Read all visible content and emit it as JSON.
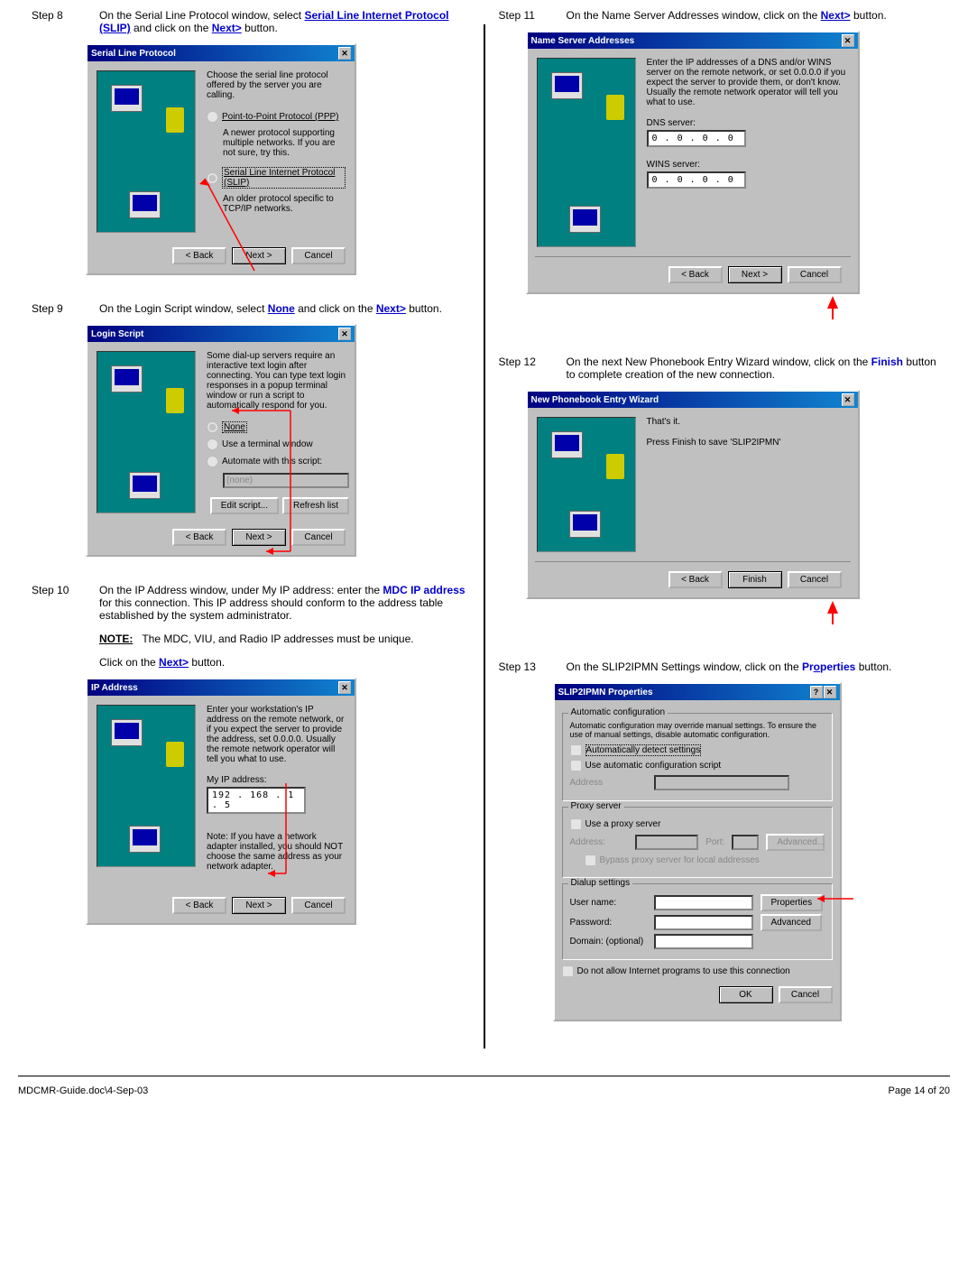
{
  "footer": {
    "left": "MDCMR-Guide.doc\\4-Sep-03",
    "right": "Page 14 of 20"
  },
  "steps": {
    "s8": {
      "label": "Step 8",
      "text_pre": "On the Serial Line Protocol window, select ",
      "text_bold": "Serial Line Internet Protocol (SLIP)",
      "text_mid": " and click on the ",
      "text_next": "Next>",
      "text_post": " button."
    },
    "s9": {
      "label": "Step 9",
      "text_pre": "On the Login Script window, select ",
      "text_bold": "None",
      "text_mid": " and click on the ",
      "text_next": "Next>",
      "text_post": " button."
    },
    "s10": {
      "label": "Step 10",
      "text_pre": "On the IP Address window, under My IP address: enter the ",
      "text_bold": "MDC IP address",
      "text_post": " for this connection.  This IP address should conform to the address table established by the system administrator.",
      "note_label": "NOTE:",
      "note_text": "The MDC, VIU, and Radio IP addresses must be unique.",
      "click_pre": "Click on the ",
      "click_next": "Next>",
      "click_post": " button."
    },
    "s11": {
      "label": "Step 11",
      "text_pre": "On the Name Server Addresses window, click on the ",
      "text_next": "Next>",
      "text_post": " button."
    },
    "s12": {
      "label": "Step 12",
      "text_pre": "On the next New Phonebook Entry Wizard window, click on the ",
      "text_bold": "Finish",
      "text_post": " button to complete creation of the new connection."
    },
    "s13": {
      "label": "Step 13",
      "text_pre": "On the SLIP2IPMN Settings window, click on the ",
      "text_bold": "Properties",
      "text_post": " button."
    }
  },
  "dlg8": {
    "title": "Serial Line Protocol",
    "intro": "Choose the serial line protocol offered by the server you are calling.",
    "opt1": "Point-to-Point Protocol (PPP)",
    "opt1_sub": "A newer protocol supporting multiple networks. If you are not sure, try this.",
    "opt2": "Serial Line Internet Protocol (SLIP)",
    "opt2_sub": "An older protocol specific to TCP/IP networks.",
    "back": "< Back",
    "next": "Next >",
    "cancel": "Cancel"
  },
  "dlg9": {
    "title": "Login Script",
    "intro": "Some dial-up servers require an interactive text login after connecting. You can type text login responses in a popup terminal window or run a script to automatically respond for you.",
    "opt1": "None",
    "opt2": "Use a terminal window",
    "opt3": "Automate with this script:",
    "select_val": "(none)",
    "edit": "Edit script...",
    "refresh": "Refresh list",
    "back": "< Back",
    "next": "Next >",
    "cancel": "Cancel"
  },
  "dlg10": {
    "title": "IP Address",
    "intro": "Enter your workstation's IP address on the remote network, or if you expect the server to provide the address, set 0.0.0.0. Usually the remote network operator will tell you what to use.",
    "field": "My IP address:",
    "ip": "192 . 168 .   1  .   5",
    "note": "Note: If you have a network adapter installed, you should NOT choose the same address as your network adapter.",
    "back": "< Back",
    "next": "Next >",
    "cancel": "Cancel"
  },
  "dlg11": {
    "title": "Name Server Addresses",
    "intro": "Enter the IP addresses of a DNS and/or WINS server on the remote network, or set 0.0.0.0 if you expect the server to provide them, or don't know. Usually the remote network operator will tell you what to use.",
    "dns": "DNS server:",
    "dns_ip": "0  .  0  .   0  .  0",
    "wins": "WINS server:",
    "wins_ip": "0  .  0  .   0  .  0",
    "back": "< Back",
    "next": "Next >",
    "cancel": "Cancel"
  },
  "dlg12": {
    "title": "New Phonebook Entry Wizard",
    "line1": "That's it.",
    "line2": "Press Finish to save 'SLIP2IPMN'",
    "back": "< Back",
    "finish": "Finish",
    "cancel": "Cancel"
  },
  "dlg13": {
    "title": "SLIP2IPMN Properties",
    "fs1": "Automatic configuration",
    "fs1_intro": "Automatic configuration may override manual settings. To ensure the use of manual settings, disable automatic configuration.",
    "chk1": "Automatically detect settings",
    "chk2": "Use automatic configuration script",
    "addr": "Address",
    "fs2": "Proxy server",
    "chk3": "Use a proxy server",
    "addr2": "Address:",
    "port": "Port:",
    "adv": "Advanced...",
    "chk4": "Bypass proxy server for local addresses",
    "fs3": "Dialup settings",
    "user": "User name:",
    "pass": "Password:",
    "domain": "Domain: (optional)",
    "props": "Properties",
    "adv2": "Advanced",
    "chk5": "Do not allow Internet programs to use this connection",
    "ok": "OK",
    "cancel": "Cancel"
  }
}
